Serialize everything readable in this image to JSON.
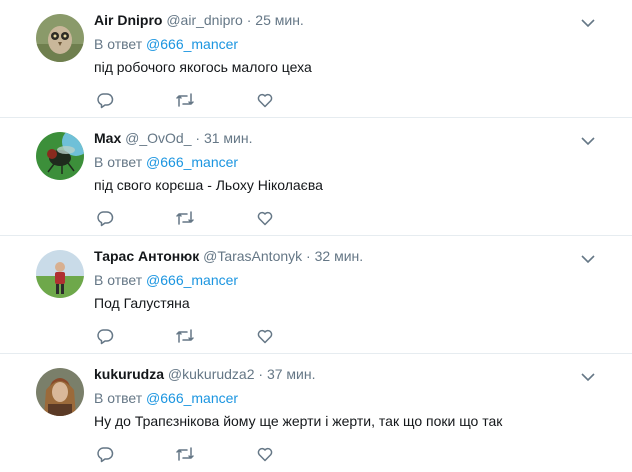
{
  "tweets": [
    {
      "name": "Air Dnipro",
      "handle": "@air_dnipro",
      "separator": "·",
      "time": "25 мин.",
      "reply_prefix": "В ответ",
      "reply_mention": "@666_mancer",
      "text": "під робочого якогось малого цеха",
      "avatar": "owl-photo"
    },
    {
      "name": "Max",
      "handle": "@_OvOd_",
      "separator": "·",
      "time": "31 мин.",
      "reply_prefix": "В ответ",
      "reply_mention": "@666_mancer",
      "text": "під свого корєша - Льоху Ніколаєва",
      "avatar": "fly-photo"
    },
    {
      "name": "Тарас Антонюк",
      "handle": "@TarasAntonyk",
      "separator": "·",
      "time": "32 мин.",
      "reply_prefix": "В ответ",
      "reply_mention": "@666_mancer",
      "text": "Под Галустяна",
      "avatar": "person-field-photo"
    },
    {
      "name": "kukurudza",
      "handle": "@kukurudza2",
      "separator": "·",
      "time": "37 мин.",
      "reply_prefix": "В ответ",
      "reply_mention": "@666_mancer",
      "text": "Ну до Трапєзнікова йому ще жерти і жерти, так що поки що так",
      "avatar": "woman-headscarf-photo"
    }
  ],
  "icons": {
    "reply": "reply-icon",
    "retweet": "retweet-icon",
    "like": "heart-icon",
    "menu": "chevron-down-icon"
  },
  "colors": {
    "name": "#14171a",
    "meta": "#657786",
    "mention": "#1b95e0",
    "divider": "#e6ecf0"
  }
}
